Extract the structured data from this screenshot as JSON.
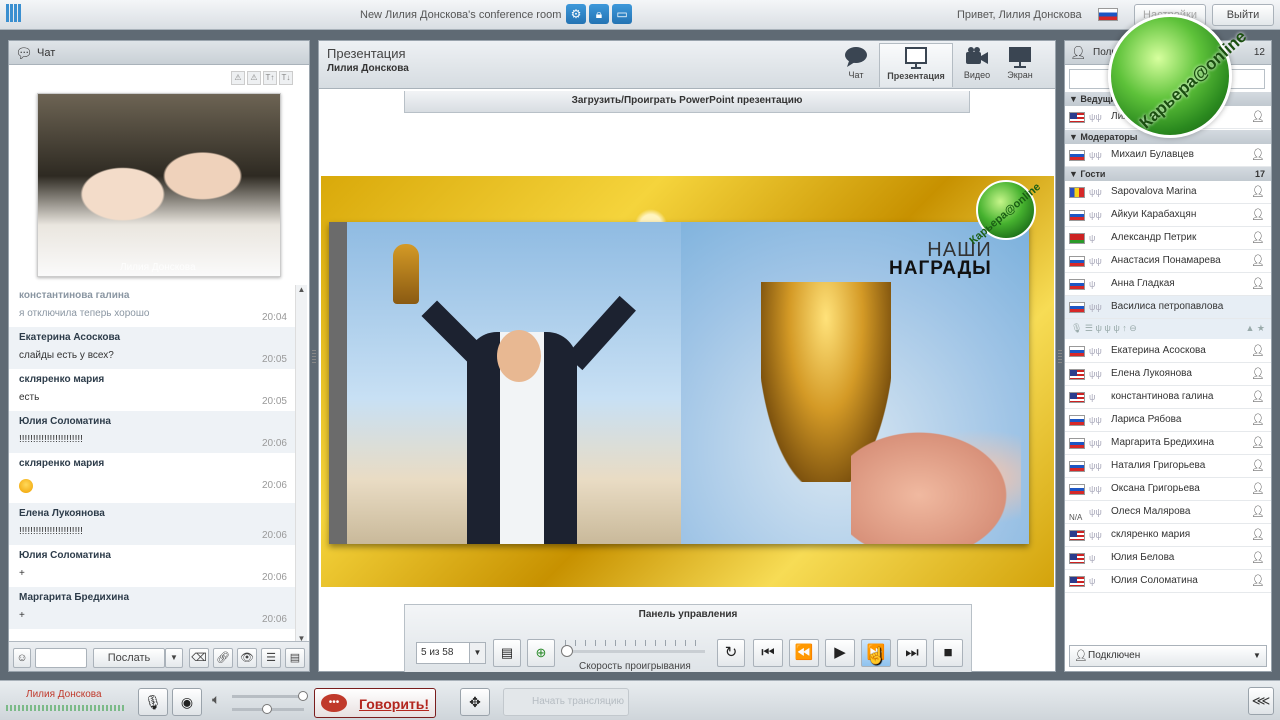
{
  "topbar": {
    "room_title": "New Лилия Донскова's conference room",
    "greeting": "Привет, Лилия Донскова",
    "settings_label": "Настройки",
    "logout_label": "Выйти",
    "tools": [
      "gear-icon",
      "lock-icon",
      "window-icon"
    ]
  },
  "chat": {
    "title": "Чат",
    "toolbar": [
      "⚠",
      "⚠",
      "T↑",
      "T↓"
    ],
    "video_caption": "Лилия Донскова",
    "messages": [
      {
        "name": "константинова галина",
        "text": "я отключила теперь хорошо",
        "time": "20:04",
        "faded": true
      },
      {
        "name": "Екатерина Асоскова",
        "text": "слайды есть у всех?",
        "time": "20:05"
      },
      {
        "name": "скляренко мария",
        "text": "есть",
        "time": "20:05"
      },
      {
        "name": "Юлия Соломатина",
        "text": "!!!!!!!!!!!!!!!!!!!!!!!",
        "time": "20:06"
      },
      {
        "name": "скляренко мария",
        "text": "",
        "time": "20:06",
        "emoji": true
      },
      {
        "name": "Елена Лукоянова",
        "text": "!!!!!!!!!!!!!!!!!!!!!!!",
        "time": "20:06"
      },
      {
        "name": "Юлия Соломатина",
        "text": "+",
        "time": "20:06"
      },
      {
        "name": "Маргарита Бредихина",
        "text": "+",
        "time": "20:06"
      }
    ],
    "send_label": "Послать"
  },
  "presentation": {
    "title": "Презентация",
    "owner": "Лилия Донскова",
    "tabs": [
      {
        "label": "Чат",
        "icon": "chat-bubble-icon"
      },
      {
        "label": "Презентация",
        "icon": "presentation-board-icon"
      },
      {
        "label": "Видео",
        "icon": "video-camera-icon"
      },
      {
        "label": "Экран",
        "icon": "monitor-icon"
      }
    ],
    "upload_label": "Загрузить/Проиграть PowerPoint презентацию",
    "slide": {
      "heading_light": "НАШИ",
      "heading_bold": "НАГРАДЫ",
      "logo_text": "Карьера@online"
    },
    "control": {
      "title": "Панель управления",
      "slide_select": "5 из 58",
      "speed_label": "Скорость проигрывания"
    }
  },
  "users": {
    "title": "Пользователи",
    "count_label": "12",
    "groups": [
      {
        "label": "Ведущий",
        "count": ""
      },
      {
        "label": "Модераторы",
        "count": ""
      },
      {
        "label": "Гости",
        "count": "17"
      }
    ],
    "host": [
      {
        "name": "Лилия Донскова",
        "flag": "us"
      }
    ],
    "moderators": [
      {
        "name": "Михаил Булавцев",
        "flag": "ru"
      }
    ],
    "guests": [
      {
        "name": "Sapovalova Marina",
        "flag": "md"
      },
      {
        "name": "Айкуи Карабахцян",
        "flag": "ru"
      },
      {
        "name": "Александр Петрик",
        "flag": "by"
      },
      {
        "name": "Анастасия Понамарева",
        "flag": "ru"
      },
      {
        "name": "Анна Гладкая",
        "flag": "ru"
      },
      {
        "name": "Василиса петропавлова",
        "flag": "ru"
      },
      {
        "name": "Екатерина Асоскова",
        "flag": "ru"
      },
      {
        "name": "Елена Лукоянова",
        "flag": "us"
      },
      {
        "name": "константинова галина",
        "flag": "us"
      },
      {
        "name": "Лариса Рябова",
        "flag": "ru"
      },
      {
        "name": "Маргарита Бредихина",
        "flag": "ru"
      },
      {
        "name": "Наталия Григорьева",
        "flag": "ru"
      },
      {
        "name": "Оксана Григорьева",
        "flag": "ru"
      },
      {
        "name": "Олеся Малярова",
        "flag": "na"
      },
      {
        "name": "скляренко мария",
        "flag": "us"
      },
      {
        "name": "Юлия Белова",
        "flag": "us"
      },
      {
        "name": "Юлия Соломатина",
        "flag": "us"
      }
    ],
    "status": "Подключен",
    "overlay_logo": "Карьера@online"
  },
  "bottombar": {
    "me": "Лилия Донскова",
    "talk_label": "Говорить!",
    "talk_icon_text": "•••",
    "disabled_label": "Начать трансляцию"
  }
}
